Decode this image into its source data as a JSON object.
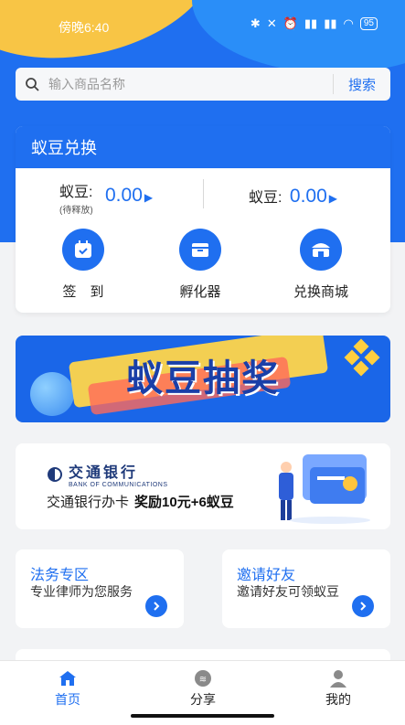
{
  "status_bar": {
    "time": "傍晚6:40",
    "battery": "95"
  },
  "search": {
    "placeholder": "输入商品名称",
    "button": "搜索"
  },
  "bean_card": {
    "title": "蚁豆兑换",
    "pending": {
      "label": "蚁豆:",
      "sub": "(待释放)",
      "value": "0.00"
    },
    "available": {
      "label": "蚁豆:",
      "value": "0.00"
    },
    "actions": [
      {
        "label": "签　到",
        "icon": "calendar-check-icon"
      },
      {
        "label": "孵化器",
        "icon": "box-icon"
      },
      {
        "label": "兑换商城",
        "icon": "shop-icon"
      }
    ]
  },
  "lottery_banner": {
    "title": "蚁豆抽奖"
  },
  "bank_promo": {
    "bank_name": "交通银行",
    "bank_name_en": "BANK OF COMMUNICATIONS",
    "text": "交通银行办卡",
    "bonus": "奖励10元+6蚁豆"
  },
  "service_cards": [
    {
      "title": "法务专区",
      "desc": "专业律师为您服务"
    },
    {
      "title": "邀请好友",
      "desc": "邀请好友可领蚁豆"
    }
  ],
  "tabbar": [
    {
      "label": "首页",
      "icon": "home-icon",
      "active": true
    },
    {
      "label": "分享",
      "icon": "share-icon",
      "active": false
    },
    {
      "label": "我的",
      "icon": "user-icon",
      "active": false
    }
  ],
  "colors": {
    "primary": "#1f6ff0",
    "accent_yellow": "#f8c545"
  }
}
